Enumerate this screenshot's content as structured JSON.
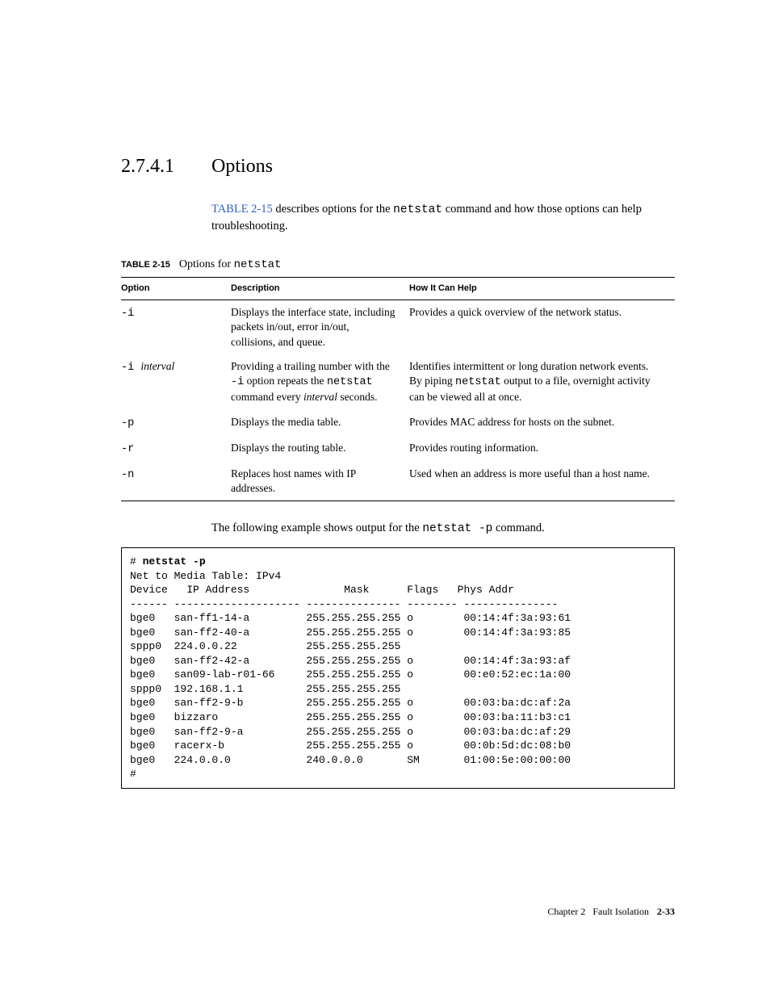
{
  "heading": {
    "number": "2.7.4.1",
    "title": "Options"
  },
  "intro": {
    "xref": "TABLE 2-15",
    "before": " describes options for the ",
    "cmd": "netstat",
    "after": " command and how those options can help troubleshooting."
  },
  "table_caption": {
    "label": "TABLE 2-15",
    "title_before": "Options for ",
    "title_cmd": "netstat"
  },
  "columns": {
    "c1": "Option",
    "c2": "Description",
    "c3": "How It Can Help"
  },
  "rows": [
    {
      "opt": "-i",
      "opt_tail": "",
      "desc": "Displays the interface state, including packets in/out, error in/out, collisions, and queue.",
      "help": "Provides a quick overview of the network status."
    },
    {
      "opt": "-i ",
      "opt_tail": "interval",
      "desc_pre": "Providing a trailing number with the ",
      "desc_code1": "-i",
      "desc_mid": " option repeats the ",
      "desc_code2": "netstat",
      "desc_mid2": " command every ",
      "desc_ital": "interval",
      "desc_post": " seconds.",
      "help_pre": "Identifies intermittent or long duration network events. By piping ",
      "help_code": "netstat",
      "help_post": " output to a file, overnight activity can be viewed all at once."
    },
    {
      "opt": "-p",
      "opt_tail": "",
      "desc": "Displays the media table.",
      "help": "Provides MAC address for hosts on the subnet."
    },
    {
      "opt": "-r",
      "opt_tail": "",
      "desc": "Displays the routing table.",
      "help": "Provides routing information."
    },
    {
      "opt": "-n",
      "opt_tail": "",
      "desc": "Replaces host names with IP addresses.",
      "help": "Used when an address is more useful than a host name."
    }
  ],
  "example_intro": {
    "before": "The following example shows output for the ",
    "cmd": "netstat -p",
    "after": " command."
  },
  "code": {
    "prompt": "# ",
    "command": "netstat -p",
    "header": "Net to Media Table: IPv4",
    "cols": "Device   IP Address               Mask      Flags   Phys Addr",
    "rule": "------ -------------------- --------------- -------- ---------------",
    "lines": [
      "bge0   san-ff1-14-a         255.255.255.255 o        00:14:4f:3a:93:61",
      "bge0   san-ff2-40-a         255.255.255.255 o        00:14:4f:3a:93:85",
      "sppp0  224.0.0.22           255.255.255.255",
      "bge0   san-ff2-42-a         255.255.255.255 o        00:14:4f:3a:93:af",
      "bge0   san09-lab-r01-66     255.255.255.255 o        00:e0:52:ec:1a:00",
      "sppp0  192.168.1.1          255.255.255.255",
      "bge0   san-ff2-9-b          255.255.255.255 o        00:03:ba:dc:af:2a",
      "bge0   bizzaro              255.255.255.255 o        00:03:ba:11:b3:c1",
      "bge0   san-ff2-9-a          255.255.255.255 o        00:03:ba:dc:af:29",
      "bge0   racerx-b             255.255.255.255 o        00:0b:5d:dc:08:b0",
      "bge0   224.0.0.0            240.0.0.0       SM       01:00:5e:00:00:00"
    ],
    "endprompt": "#"
  },
  "footer": {
    "chapter": "Chapter 2",
    "title": "Fault Isolation",
    "page": "2-33"
  }
}
